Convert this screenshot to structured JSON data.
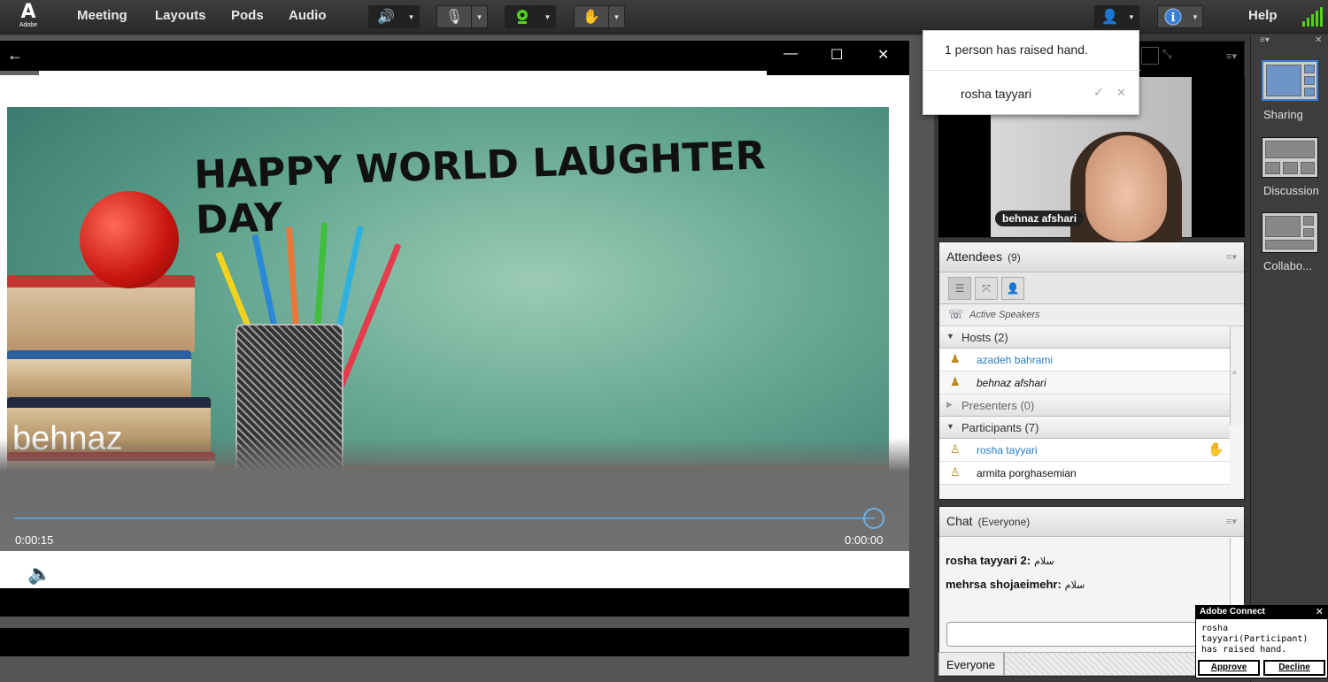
{
  "menubar": {
    "logo_text": "Adobe",
    "items": [
      "Meeting",
      "Layouts",
      "Pods",
      "Audio"
    ],
    "help": "Help"
  },
  "colors": {
    "accent_green": "#54d21b",
    "link_blue": "#2b7fc2",
    "chat_bg": "#f4f4f4"
  },
  "video": {
    "headline": "HAPPY WORLD LAUGHTER DAY",
    "overlay_name": "behnaz",
    "time_elapsed": "0:00:15",
    "time_remaining": "0:00:00",
    "progress": 0.99,
    "replay_seconds": "10",
    "skip_seconds": "30"
  },
  "raise_hand_popup": {
    "summary": "1 person has raised hand.",
    "person": "rosha tayyari"
  },
  "camera": {
    "label": "behnaz afshari"
  },
  "attendees": {
    "title": "Attendees",
    "count": "(9)",
    "active_speakers": "Active Speakers",
    "hosts_label": "Hosts (2)",
    "hosts": [
      "azadeh bahrami",
      "behnaz afshari"
    ],
    "presenters_label": "Presenters (0)",
    "participants_label": "Participants (7)",
    "participants": [
      "rosha tayyari",
      "armita porghasemian"
    ]
  },
  "chat": {
    "title": "Chat",
    "scope": "(Everyone)",
    "messages": [
      {
        "sender": "rosha tayyari 2:",
        "text": "سلام"
      },
      {
        "sender": "mehrsa shojaeimehr:",
        "text": "سلام"
      }
    ],
    "to": "Everyone"
  },
  "layouts": [
    "Sharing",
    "Discussion",
    "Collabo..."
  ],
  "toast": {
    "title": "Adobe Connect",
    "message": "rosha tayyari(Participant) has raised hand.",
    "approve": "Approve",
    "decline": "Decline"
  }
}
